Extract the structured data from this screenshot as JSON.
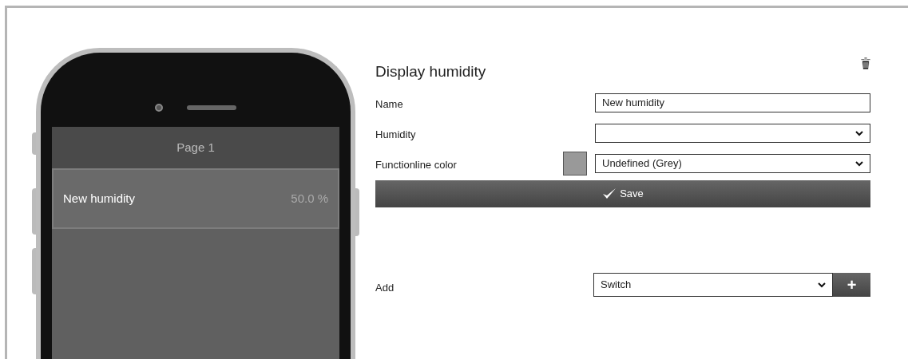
{
  "phone": {
    "page_title": "Page 1",
    "items": [
      {
        "name": "New humidity",
        "value": "50.0 %",
        "selected": true
      }
    ]
  },
  "editor": {
    "title": "Display humidity",
    "fields": [
      {
        "kind": "text",
        "label": "Name",
        "value": "New humidity"
      },
      {
        "kind": "select",
        "label": "Humidity"
      },
      {
        "kind": "color",
        "label": "Functionline color",
        "value": "Undefined (Grey)",
        "color": "#999999"
      }
    ],
    "save_button": "Save",
    "add": {
      "label": "Add",
      "value": "Switch",
      "button": "+"
    }
  }
}
